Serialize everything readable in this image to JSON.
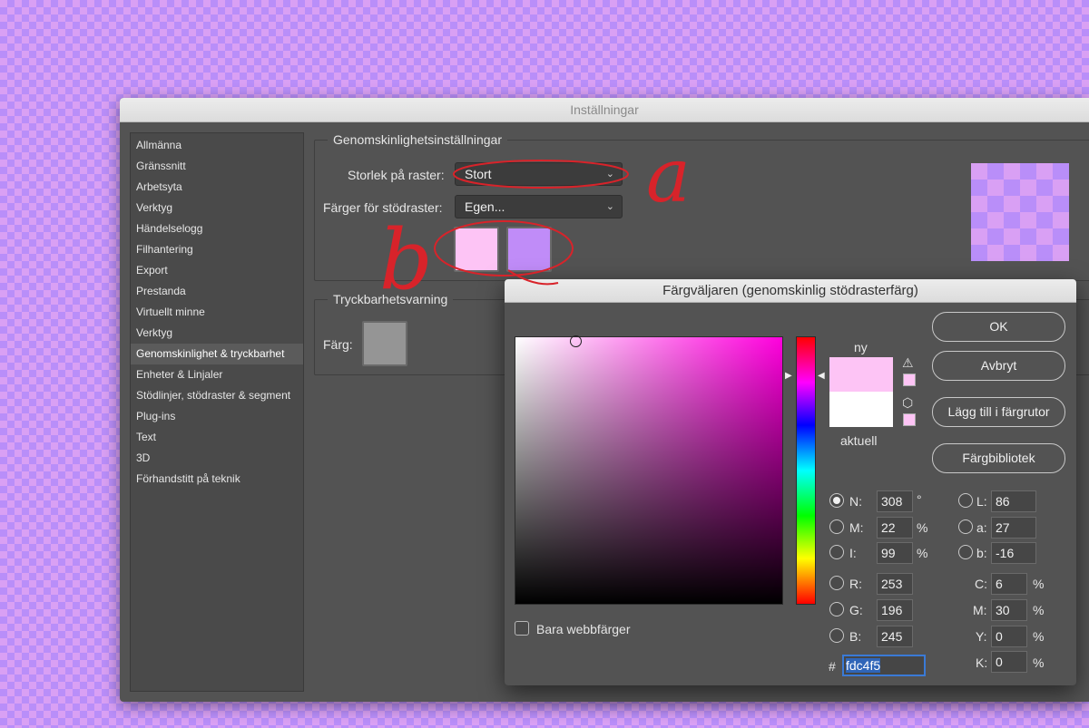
{
  "window_title": "Inställningar",
  "sidebar": {
    "items": [
      {
        "label": "Allmänna"
      },
      {
        "label": "Gränssnitt"
      },
      {
        "label": "Arbetsyta"
      },
      {
        "label": "Verktyg"
      },
      {
        "label": "Händelselogg"
      },
      {
        "label": "Filhantering"
      },
      {
        "label": "Export"
      },
      {
        "label": "Prestanda"
      },
      {
        "label": "Virtuellt minne"
      },
      {
        "label": "Verktyg"
      },
      {
        "label": "Genomskinlighet & tryckbarhet",
        "active": true
      },
      {
        "label": "Enheter & Linjaler"
      },
      {
        "label": "Stödlinjer, stödraster & segment"
      },
      {
        "label": "Plug-ins"
      },
      {
        "label": "Text"
      },
      {
        "label": "3D"
      },
      {
        "label": "Förhandstitt på teknik"
      }
    ]
  },
  "transparency": {
    "title": "Genomskinlighetsinställningar",
    "grid_size_label": "Storlek på raster:",
    "grid_size_value": "Stort",
    "grid_colors_label": "Färger för stödraster:",
    "grid_colors_value": "Egen...",
    "swatch_colors": [
      "#fdc4f5",
      "#c08cf8"
    ]
  },
  "gamut": {
    "title": "Tryckbarhetsvarning",
    "color_label": "Färg:",
    "color": "#959595"
  },
  "annotations": {
    "a": "a",
    "b": "b",
    "color": "#d8232a"
  },
  "picker": {
    "title": "Färgväljaren (genomskinlig stödrasterfärg)",
    "new_label": "ny",
    "current_label": "aktuell",
    "new_color": "#fdc4f5",
    "current_color": "#ffffff",
    "buttons": {
      "ok": "OK",
      "cancel": "Avbryt",
      "add_swatches": "Lägg till i färgrutor",
      "libraries": "Färgbibliotek"
    },
    "hsb": {
      "h_label": "N:",
      "h_value": "308",
      "h_unit": "°",
      "s_label": "M:",
      "s_value": "22",
      "s_unit": "%",
      "b_label": "I:",
      "b_value": "99",
      "b_unit": "%"
    },
    "rgb": {
      "r_label": "R:",
      "r_value": "253",
      "g_label": "G:",
      "g_value": "196",
      "b_label": "B:",
      "b_value": "245"
    },
    "lab": {
      "l_label": "L:",
      "l_value": "86",
      "a_label": "a:",
      "a_value": "27",
      "b_label": "b:",
      "b_value": "-16"
    },
    "cmyk": {
      "c_label": "C:",
      "c_value": "6",
      "m_label": "M:",
      "m_value": "30",
      "y_label": "Y:",
      "y_value": "0",
      "k_label": "K:",
      "k_value": "0",
      "unit": "%"
    },
    "hex_label": "#",
    "hex_value": "fdc4f5",
    "web_only_label": "Bara webbfärger",
    "selected_mode": "N"
  }
}
